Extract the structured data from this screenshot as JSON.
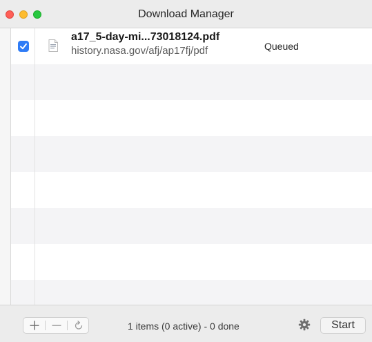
{
  "window": {
    "title": "Download Manager"
  },
  "downloads": [
    {
      "checked": true,
      "file_icon": "pdf-document-icon",
      "name": "a17_5-day-mi...73018124.pdf",
      "url": "history.nasa.gov/afj/ap17fj/pdf",
      "status": "Queued"
    }
  ],
  "footer": {
    "add_icon": "plus-icon",
    "remove_icon": "minus-icon",
    "retry_icon": "refresh-icon",
    "summary": "1 items (0 active) - 0 done",
    "settings_icon": "gear-icon",
    "start_label": "Start"
  },
  "colors": {
    "accent": "#2f7cf6",
    "close": "#ff5f57",
    "minimize": "#febc2e",
    "maximize": "#28c840"
  }
}
